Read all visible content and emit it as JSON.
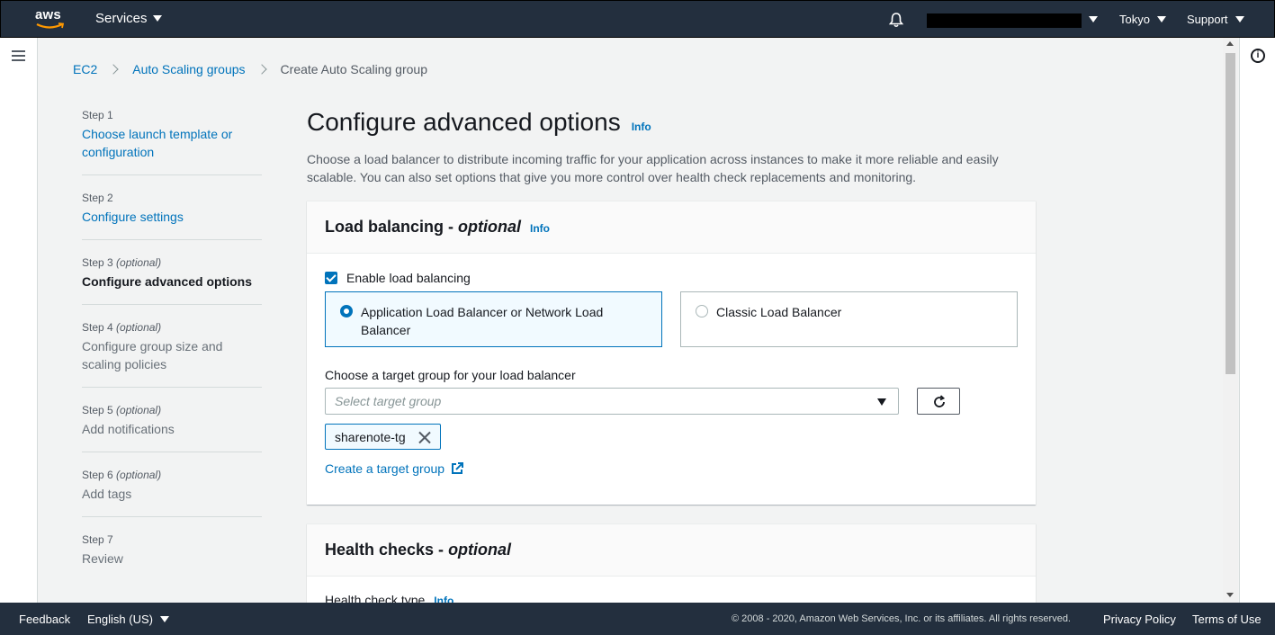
{
  "topnav": {
    "logo_text": "aws",
    "services_label": "Services",
    "region_label": "Tokyo",
    "support_label": "Support"
  },
  "breadcrumb": {
    "items": [
      "EC2",
      "Auto Scaling groups"
    ],
    "current": "Create Auto Scaling group"
  },
  "steps": [
    {
      "num": "Step 1",
      "optional": "",
      "title": "Choose launch template or configuration",
      "state": "link"
    },
    {
      "num": "Step 2",
      "optional": "",
      "title": "Configure settings",
      "state": "link"
    },
    {
      "num": "Step 3",
      "optional": "(optional)",
      "title": "Configure advanced options",
      "state": "active"
    },
    {
      "num": "Step 4",
      "optional": "(optional)",
      "title": "Configure group size and scaling policies",
      "state": "disabled"
    },
    {
      "num": "Step 5",
      "optional": "(optional)",
      "title": "Add notifications",
      "state": "disabled"
    },
    {
      "num": "Step 6",
      "optional": "(optional)",
      "title": "Add tags",
      "state": "disabled"
    },
    {
      "num": "Step 7",
      "optional": "",
      "title": "Review",
      "state": "disabled"
    }
  ],
  "main": {
    "title": "Configure advanced options",
    "info": "Info",
    "description": "Choose a load balancer to distribute incoming traffic for your application across instances to make it more reliable and easily scalable. You can also set options that give you more control over health check replacements and monitoring."
  },
  "load_balancing": {
    "title": "Load balancing - ",
    "title_optional": "optional",
    "info": "Info",
    "enable_label": "Enable load balancing",
    "enabled": true,
    "options": [
      {
        "label": "Application Load Balancer or Network Load Balancer",
        "selected": true
      },
      {
        "label": "Classic Load Balancer",
        "selected": false
      }
    ],
    "target_group_label": "Choose a target group for your load balancer",
    "target_group_placeholder": "Select target group",
    "selected_token": "sharenote-tg",
    "create_link": "Create a target group"
  },
  "health_checks": {
    "title": "Health checks - ",
    "title_optional": "optional",
    "type_label": "Health check type",
    "info": "Info"
  },
  "footer": {
    "feedback": "Feedback",
    "language": "English (US)",
    "copyright": "© 2008 - 2020, Amazon Web Services, Inc. or its affiliates. All rights reserved.",
    "privacy": "Privacy Policy",
    "terms": "Terms of Use"
  },
  "colors": {
    "nav_bg": "#232f3e",
    "link": "#0073bb",
    "selected_tile_bg": "#f1faff"
  }
}
